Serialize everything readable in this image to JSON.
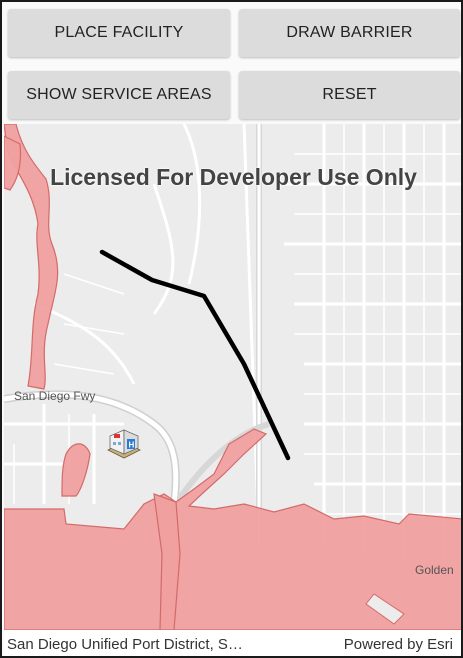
{
  "toolbar": {
    "place_facility": "PLACE FACILITY",
    "draw_barrier": "DRAW BARRIER",
    "show_service_areas": "SHOW SERVICE AREAS",
    "reset": "RESET"
  },
  "map": {
    "watermark": "Licensed For Developer Use Only",
    "road_label": "San Diego Fwy",
    "place_label": "Golden",
    "facility_icon": "hospital-icon",
    "barrier_icon": "barrier-line",
    "colors": {
      "service_area_fill": "#f0a0a0",
      "service_area_stroke": "#d36a6a",
      "barrier": "#000000",
      "basemap": "#ececec",
      "road": "#ffffff"
    }
  },
  "attribution": {
    "source": "San Diego Unified Port District, S…",
    "powered_by": "Powered by Esri"
  }
}
